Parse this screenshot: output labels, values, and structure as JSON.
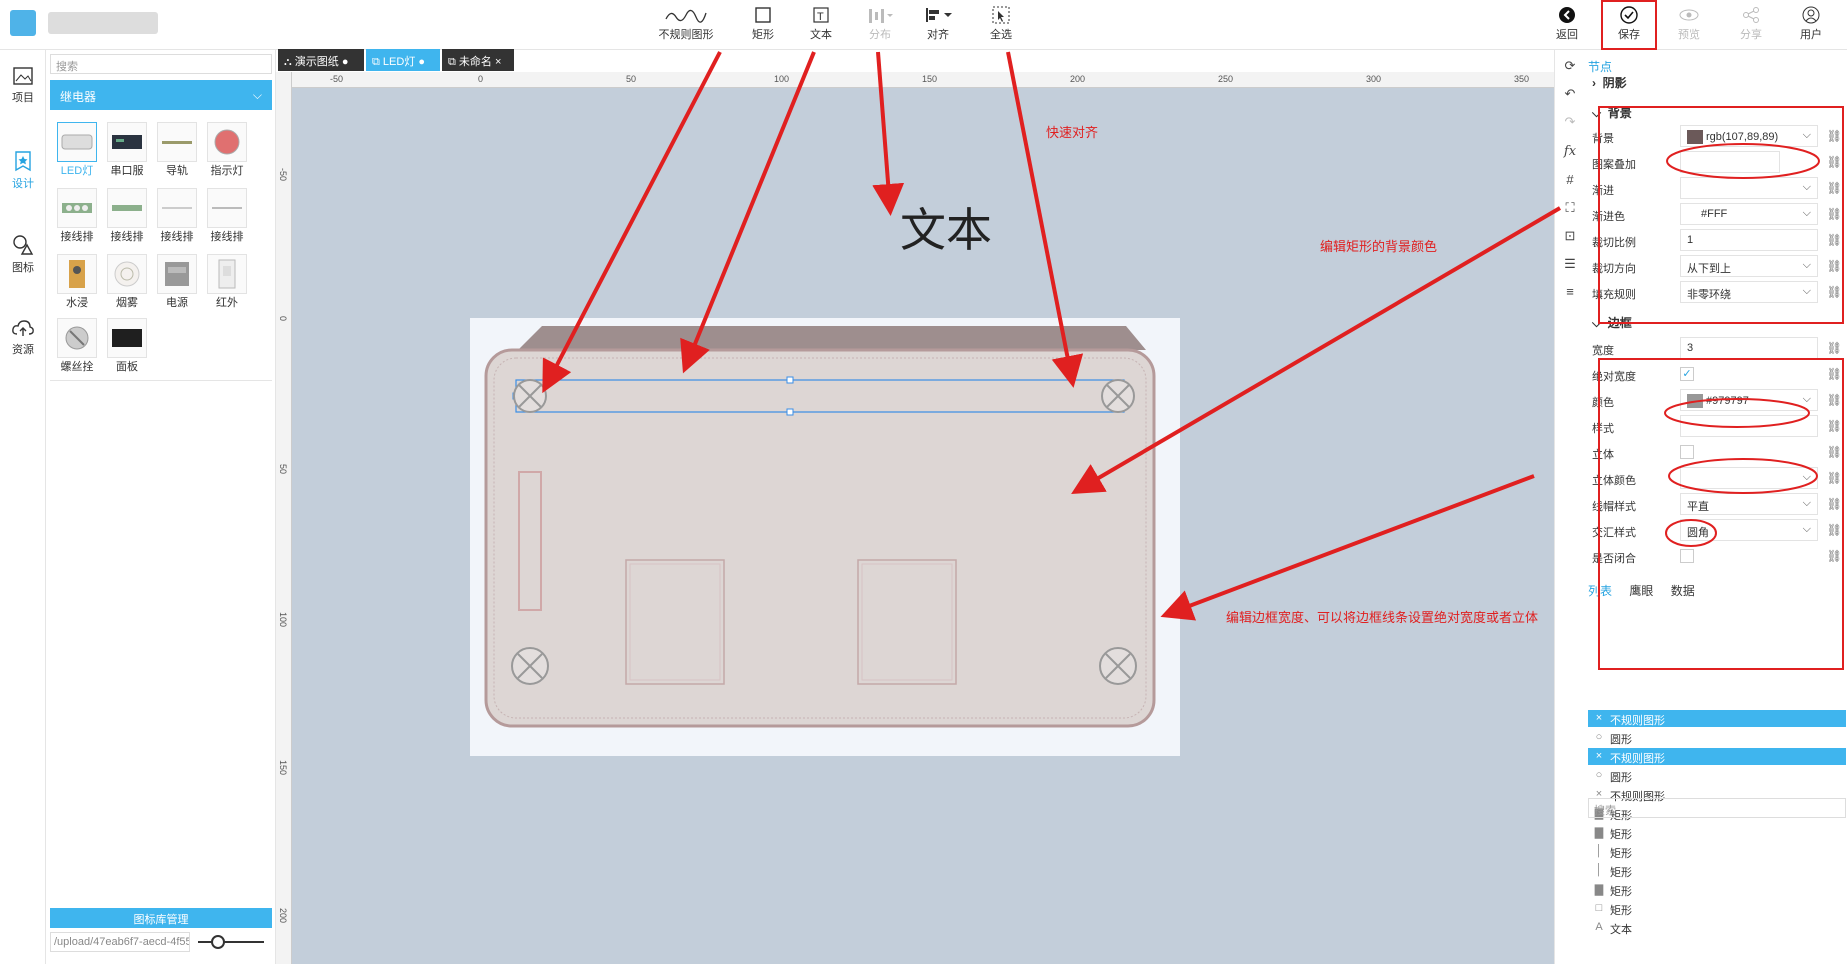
{
  "toolbar": {
    "items": [
      {
        "label": "不规则图形",
        "icon": "irregular-shape-icon"
      },
      {
        "label": "矩形",
        "icon": "rectangle-icon"
      },
      {
        "label": "文本",
        "icon": "text-icon"
      },
      {
        "label": "分布",
        "icon": "distribute-icon"
      },
      {
        "label": "对齐",
        "icon": "align-icon"
      },
      {
        "label": "全选",
        "icon": "select-all-icon"
      }
    ],
    "right": [
      {
        "label": "返回",
        "icon": "back-icon"
      },
      {
        "label": "保存",
        "icon": "save-icon"
      },
      {
        "label": "预览",
        "icon": "preview-icon"
      },
      {
        "label": "分享",
        "icon": "share-icon"
      },
      {
        "label": "用户",
        "icon": "user-icon"
      }
    ]
  },
  "leftnav": {
    "items": [
      {
        "label": "项目",
        "icon": "image-icon"
      },
      {
        "label": "设计",
        "icon": "design-icon"
      },
      {
        "label": "图标",
        "icon": "shapes-icon"
      },
      {
        "label": "资源",
        "icon": "cloud-upload-icon"
      }
    ]
  },
  "leftpanel": {
    "search_placeholder": "搜索",
    "category": "继电器",
    "components": [
      "LED灯",
      "串口服",
      "导轨",
      "指示灯",
      "接线排",
      "接线排",
      "接线排",
      "接线排",
      "水浸",
      "烟雾",
      "电源",
      "红外",
      "螺丝拴",
      "面板"
    ],
    "library_manager": "图标库管理",
    "upload_path": "/upload/47eab6f7-aecd-4f55-b29"
  },
  "tabs": [
    {
      "label": "演示图纸",
      "dot": "●"
    },
    {
      "label": "LED灯",
      "dot": "●"
    },
    {
      "label": "未命名",
      "dot": "×"
    }
  ],
  "ruler": {
    "top_ticks": [
      "-50",
      "0",
      "50",
      "100",
      "150",
      "200",
      "250",
      "300",
      "350"
    ],
    "left_ticks": [
      "-50",
      "0",
      "50",
      "100",
      "150",
      "200"
    ]
  },
  "canvas": {
    "text_element": "文本"
  },
  "annotations": {
    "quick_align": "快速对齐",
    "edit_bg": "编辑矩形的背景颜色",
    "edit_border": "编辑边框宽度、可以将边框线条设置绝对宽度或者立体"
  },
  "props": {
    "title": "节点",
    "shadow_section": "阴影",
    "bg_section": "背景",
    "bg_rows": [
      {
        "label": "背景",
        "value": "rgb(107,89,89)",
        "swatch": "#6b5959"
      },
      {
        "label": "图案叠加",
        "value": ""
      },
      {
        "label": "渐进",
        "value": ""
      },
      {
        "label": "渐进色",
        "value": "#FFF"
      },
      {
        "label": "裁切比例",
        "value": "1"
      },
      {
        "label": "裁切方向",
        "value": "从下到上"
      },
      {
        "label": "填充规则",
        "value": "非零环绕"
      }
    ],
    "border_section": "边框",
    "border_rows": [
      {
        "label": "宽度",
        "value": "3"
      },
      {
        "label": "绝对宽度",
        "value": "✓"
      },
      {
        "label": "颜色",
        "value": "#979797",
        "swatch": "#979797"
      },
      {
        "label": "样式",
        "value": ""
      },
      {
        "label": "立体",
        "value": ""
      },
      {
        "label": "立体颜色",
        "value": ""
      },
      {
        "label": "线帽样式",
        "value": "平直"
      },
      {
        "label": "交汇样式",
        "value": "圆角"
      },
      {
        "label": "是否闭合",
        "value": ""
      }
    ],
    "list_tabs": [
      "列表",
      "鹰眼",
      "数据"
    ],
    "list_items": [
      {
        "label": "不规则图形",
        "hl": true,
        "icon": "×"
      },
      {
        "label": "圆形",
        "hl": false,
        "icon": "○"
      },
      {
        "label": "不规则图形",
        "hl": true,
        "icon": "×"
      },
      {
        "label": "圆形",
        "hl": false,
        "icon": "○"
      },
      {
        "label": "不规则图形",
        "hl": false,
        "icon": "×"
      },
      {
        "label": "矩形",
        "hl": false,
        "icon": "▇"
      },
      {
        "label": "矩形",
        "hl": false,
        "icon": "▇"
      },
      {
        "label": "矩形",
        "hl": false,
        "icon": "│"
      },
      {
        "label": "矩形",
        "hl": false,
        "icon": "│"
      },
      {
        "label": "矩形",
        "hl": false,
        "icon": "▇"
      },
      {
        "label": "矩形",
        "hl": false,
        "icon": "□"
      },
      {
        "label": "文本",
        "hl": false,
        "icon": "A"
      }
    ],
    "list_search": "搜索"
  }
}
